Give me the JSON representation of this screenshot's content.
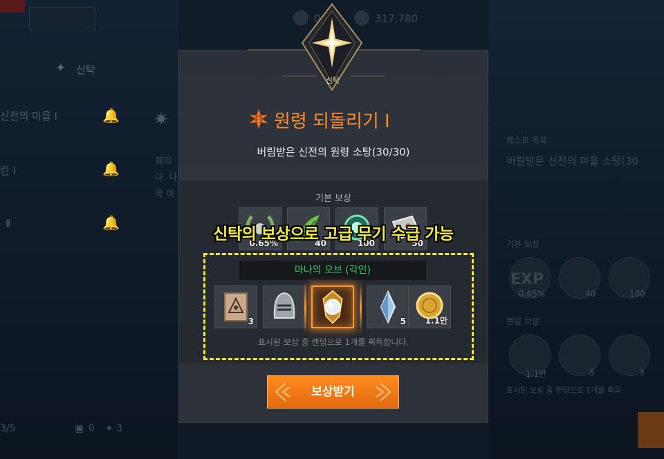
{
  "background": {
    "left_tab": "신탁",
    "left_items": [
      {
        "label": "신전의 마을 Ⅰ"
      },
      {
        "label": "린 Ⅰ"
      },
      {
        "label": "Ⅱ"
      }
    ],
    "left_fragments": [
      "퀘의",
      "다. 다",
      "목 여"
    ],
    "left_footer": {
      "page": "3/5",
      "count_a": "0",
      "count_b": "3"
    },
    "top_currency": [
      {
        "value": "0"
      },
      {
        "value": "317,780"
      }
    ],
    "right_panel": {
      "quest_goal_label": "퀘스트 목표",
      "quest_text": "버림받은 신전의 마을 소탕(30",
      "basic_reward_label": "기본 보상",
      "basic_values": [
        "0.65%",
        "40",
        "100"
      ],
      "random_reward_label": "랜덤 보상",
      "random_values": [
        "1.1만",
        "5",
        "3"
      ],
      "random_hint_fragment": "표시된 보상 중 랜덤으로 1개를 획득"
    }
  },
  "modal": {
    "emblem_label": "신탁",
    "title": "원령 되돌리기 Ⅰ",
    "subtitle": "버림받은 신전의 원령 소탕(30/30)",
    "basic_reward_label": "기본 보상",
    "basic_rewards": [
      {
        "icon": "laurel-wreath-icon",
        "value": "0.65%"
      },
      {
        "icon": "green-feather-icon",
        "value": "40"
      },
      {
        "icon": "green-orb-icon",
        "value": "100"
      },
      {
        "icon": "silver-box-icon",
        "value": "50"
      }
    ],
    "selected_item_name": "마나의 오브 (각인)",
    "random_rewards": [
      {
        "icon": "scroll-icon",
        "value": "3"
      },
      {
        "icon": "helmet-icon",
        "value": ""
      },
      {
        "icon": "mana-orb-icon",
        "value": ""
      },
      {
        "icon": "blue-crystal-icon",
        "value": "5"
      },
      {
        "icon": "gold-coin-icon",
        "value": "1.1만"
      }
    ],
    "hint": "표시된 보상 중 랜덤으로 1개를 획득합니다.",
    "claim_button": "보상받기"
  },
  "overlay_caption": "신탁의 보상으로 고급 무기 수급 가능",
  "colors": {
    "accent_orange": "#ff8a2c",
    "item_name_green": "#39c96a",
    "caption_yellow": "#f5ea3a"
  }
}
